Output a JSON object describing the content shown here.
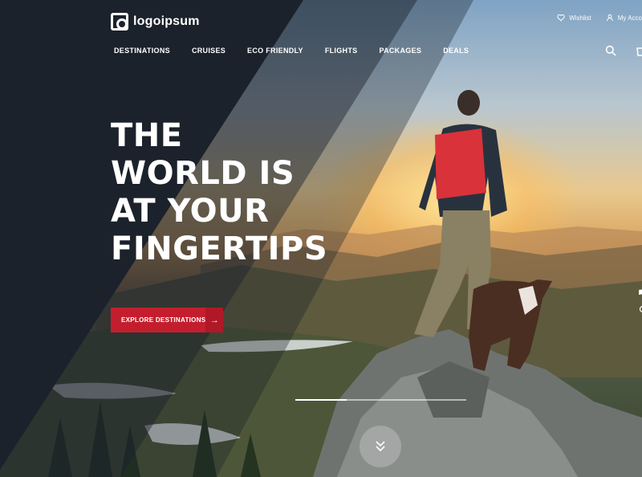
{
  "brand": {
    "logo_text": "logoipsum"
  },
  "top_links": [
    {
      "label": "Wishlist",
      "icon": "heart-icon"
    },
    {
      "label": "My Acco",
      "icon": "user-icon"
    }
  ],
  "nav": {
    "items": [
      "DESTINATIONS",
      "CRUISES",
      "ECO FRIENDLY",
      "FLIGHTS",
      "PACKAGES",
      "DEALS"
    ],
    "icons": [
      "search-icon",
      "cart-icon"
    ]
  },
  "hero": {
    "headline": [
      "THE",
      "WORLD IS",
      "AT YOUR",
      "FINGERTIPS"
    ],
    "cta_label": "EXPLORE DESTINATIONS",
    "cta_icon": "arrow-right-icon",
    "slider_progress": 0.3,
    "scroll_icon": "double-chevron-down-icon"
  },
  "colors": {
    "accent": "#c41e2e",
    "dark_panel": "#1b222c",
    "text": "#ffffff"
  }
}
